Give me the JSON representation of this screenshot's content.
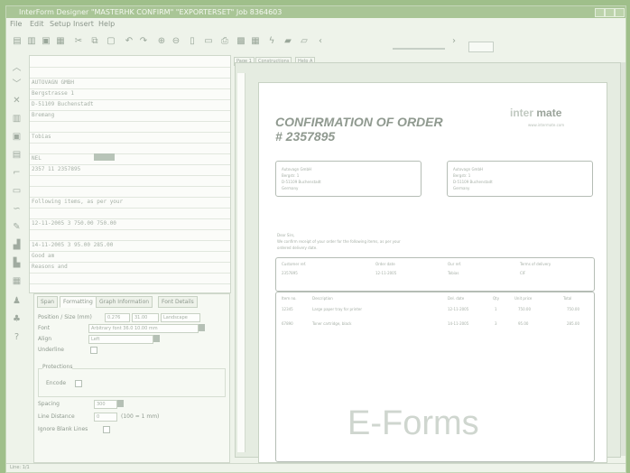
{
  "window": {
    "title": "InterForm Designer \"MASTERHK CONFIRM\" \"EXPORTERSET\" Job 8364603"
  },
  "menu": [
    "File",
    "Edit",
    "Setup",
    "Insert",
    "Help"
  ],
  "toolbar": {
    "icons": [
      "new-icon",
      "open-icon",
      "save-icon",
      "print-icon",
      "cut-icon",
      "copy-icon",
      "paste-icon",
      "undo-icon",
      "redo-icon",
      "zoom-in-icon",
      "zoom-out-icon",
      "page-icon",
      "preview-icon",
      "printer-icon",
      "image-icon",
      "grid-icon",
      "lightning-icon",
      "library-icon",
      "window-icon",
      "prev-icon",
      "next-icon"
    ]
  },
  "data_rows": [
    {
      "text": ""
    },
    {
      "text": ""
    },
    {
      "text": "              AUTOVAGN GMBH"
    },
    {
      "text": "              Bergstrasse 1"
    },
    {
      "text": "              D-51109  Buchenstadt"
    },
    {
      "text": "              Bremang"
    },
    {
      "text": ""
    },
    {
      "text": "              Tobias"
    },
    {
      "text": ""
    },
    {
      "text": "              NEL"
    },
    {
      "text": "              2357 11 2357895"
    },
    {
      "text": ""
    },
    {
      "text": ""
    },
    {
      "text": "Following items, as per your"
    },
    {
      "text": ""
    },
    {
      "text": "              12-11-2005  3   750.00     750.00"
    },
    {
      "text": ""
    },
    {
      "text": "              14-11-2005  3   95.00      285.00"
    },
    {
      "text": "Good  am"
    },
    {
      "text": "Reasons and"
    },
    {
      "text": ""
    }
  ],
  "props": {
    "tabs": [
      "Span",
      "Formatting",
      "Graph Information",
      "Font Details"
    ],
    "fields": {
      "position_label": "Position / Size (mm)",
      "position_values": [
        "0.276",
        "31.00",
        "Landscape"
      ],
      "font_label": "Font",
      "font_value": "Arbitrary font 36.0 10.00 mm",
      "align_label": "Align",
      "align_value": "Left",
      "underline_label": "Underline",
      "protection_group": "Protections",
      "protection_label": "Encode",
      "spacing_label": "Spacing",
      "spacing_value": "300",
      "jlist_label": "Line Distance",
      "jlist_value": "0",
      "jlist_unit": "(100 = 1 mm)",
      "ignore_label": "Ignore Blank Lines"
    }
  },
  "preview": {
    "tabs": [
      "Page 1",
      "Constructions",
      "Help A"
    ],
    "doc_title": "CONFIRMATION OF ORDER",
    "doc_number": "# 2357895",
    "logo_light": "inter",
    "logo_dark": "mate",
    "logo_sub": "www.intermate.com",
    "customer_address": [
      "Autovagn GmbH",
      "Bergstr. 1",
      "D-51109 Buchenstadt",
      "Germany"
    ],
    "delivery_address": [
      "Autovagn GmbH",
      "Bergstr. 1",
      "D-51109 Buchenstadt",
      "Germany"
    ],
    "greeting": "Dear Sirs,",
    "intro_lines": [
      "We confirm receipt of your order for the following items, as per your",
      "ordered delivery date."
    ],
    "order_headers": [
      "Customer ref.",
      "Order date",
      "Our ref.",
      "Terms of delivery"
    ],
    "order_values": [
      "2357895",
      "12-11-2005",
      "Tobias",
      "CIF"
    ],
    "items_headers": [
      "Item no.",
      "Description",
      "Del. date",
      "Qty",
      "Unit price",
      "Total"
    ],
    "items": [
      {
        "no": "12345",
        "desc": "Large paper tray for printer",
        "date": "12-11-2005",
        "qty": "1",
        "price": "750.00",
        "total": "750.00"
      },
      {
        "no": "67890",
        "desc": "Toner cartridge, black",
        "date": "14-11-2005",
        "qty": "3",
        "price": "95.00",
        "total": "285.00"
      }
    ],
    "watermark": "E-Forms"
  },
  "status": {
    "left": "Line: 1/1",
    "right": ""
  }
}
